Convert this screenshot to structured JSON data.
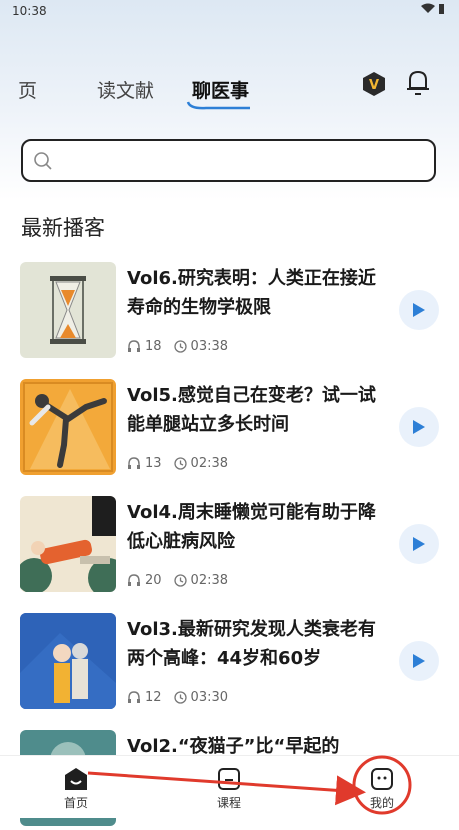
{
  "status": {
    "time": "10:38",
    "icons": "▾ ▮"
  },
  "tabs": [
    {
      "label": "页"
    },
    {
      "label": "读文献"
    },
    {
      "label": "聊医事"
    }
  ],
  "search": {
    "placeholder": ""
  },
  "section_title": "最新播客",
  "podcasts": [
    {
      "title": "Vol6.研究表明：人类正在接近寿命的生物学极限",
      "listens": "18",
      "duration": "03:38"
    },
    {
      "title": "Vol5.感觉自己在变老？试一试能单腿站立多长时间",
      "listens": "13",
      "duration": "02:38"
    },
    {
      "title": "Vol4.周末睡懒觉可能有助于降低心脏病风险",
      "listens": "20",
      "duration": "02:38"
    },
    {
      "title": "Vol3.最新研究发现人类衰老有两个高峰：44岁和60岁",
      "listens": "12",
      "duration": "03:30"
    },
    {
      "title": "Vol2.“夜猫子”比“早起的",
      "listens": "",
      "duration": ""
    }
  ],
  "bottom_nav": [
    {
      "label": "首页"
    },
    {
      "label": "课程"
    },
    {
      "label": "我的"
    }
  ],
  "colors": {
    "accent": "#2d7fd6",
    "annotation": "#e03a2c",
    "play_bg": "#e9f1fb"
  }
}
